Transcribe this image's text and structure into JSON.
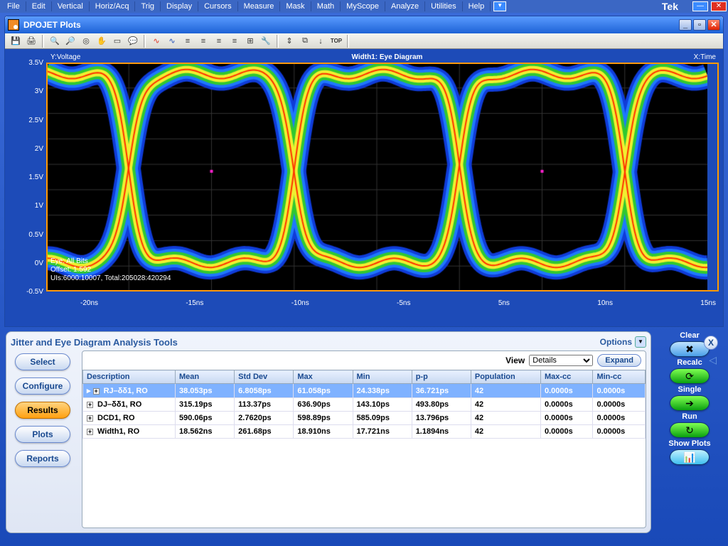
{
  "menu": {
    "items": [
      "File",
      "Edit",
      "Vertical",
      "Horiz/Acq",
      "Trig",
      "Display",
      "Cursors",
      "Measure",
      "Mask",
      "Math",
      "MyScope",
      "Analyze",
      "Utilities",
      "Help"
    ],
    "brand": "Tek"
  },
  "subwin": {
    "title": "DPOJET Plots"
  },
  "plot": {
    "ylabel": "Y:Voltage",
    "title": "Width1: Eye Diagram",
    "xlabel": "X:Time",
    "overlay": [
      "Eye: All Bits",
      "Offset: 1.592",
      "UIs:6000:10007, Total:205028:420294"
    ],
    "yticks": [
      "3.5V",
      "3V",
      "2.5V",
      "2V",
      "1.5V",
      "1V",
      "0.5V",
      "0V",
      "-0.5V"
    ],
    "xticks": [
      "-20ns",
      "-15ns",
      "-10ns",
      "-5ns",
      "5ns",
      "10ns",
      "15ns"
    ]
  },
  "panel": {
    "title": "Jitter and Eye Diagram Analysis Tools",
    "options": "Options",
    "viewlabel": "View",
    "viewvalue": "Details",
    "expand": "Expand",
    "leftbtns": [
      "Select",
      "Configure",
      "Results",
      "Plots",
      "Reports"
    ],
    "activebtn": 2,
    "cols": [
      "Description",
      "Mean",
      "Std Dev",
      "Max",
      "Min",
      "p-p",
      "Population",
      "Max-cc",
      "Min-cc"
    ],
    "rows": [
      [
        "RJ–δδ1, RO",
        "38.053ps",
        "6.8058ps",
        "61.058ps",
        "24.338ps",
        "36.721ps",
        "42",
        "0.0000s",
        "0.0000s"
      ],
      [
        "DJ–δδ1, RO",
        "315.19ps",
        "113.37ps",
        "636.90ps",
        "143.10ps",
        "493.80ps",
        "42",
        "0.0000s",
        "0.0000s"
      ],
      [
        "DCD1, RO",
        "590.06ps",
        "2.7620ps",
        "598.89ps",
        "585.09ps",
        "13.796ps",
        "42",
        "0.0000s",
        "0.0000s"
      ],
      [
        "Width1, RO",
        "18.562ns",
        "261.68ps",
        "18.910ns",
        "17.721ns",
        "1.1894ns",
        "42",
        "0.0000s",
        "0.0000s"
      ]
    ],
    "right": {
      "clear": "Clear",
      "recalc": "Recalc",
      "single": "Single",
      "run": "Run",
      "showplots": "Show Plots"
    }
  }
}
